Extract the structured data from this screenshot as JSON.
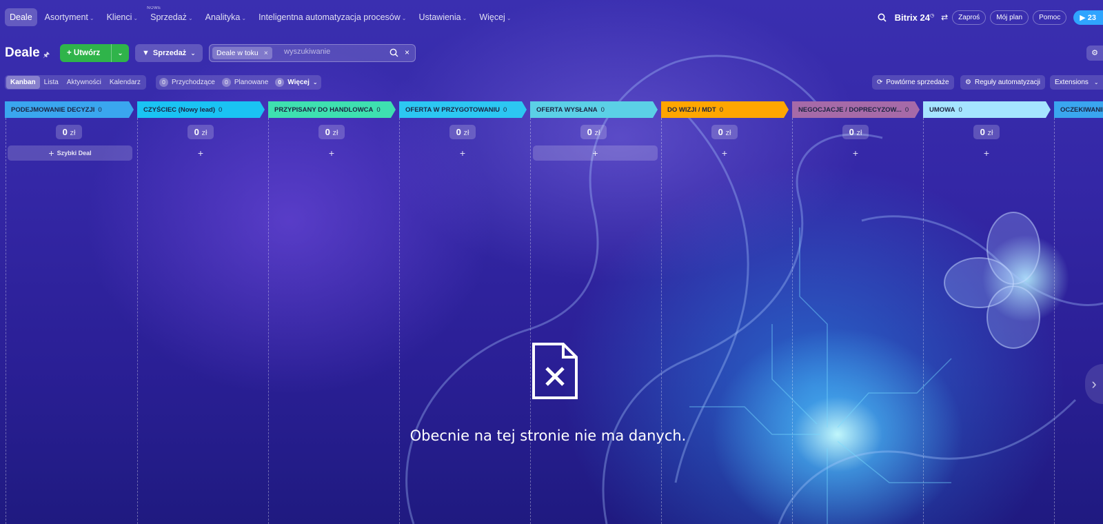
{
  "nav": {
    "items": [
      {
        "label": "Deale",
        "active": true,
        "chevron": false
      },
      {
        "label": "Asortyment",
        "chevron": true
      },
      {
        "label": "Klienci",
        "chevron": true
      },
      {
        "label": "Sprzedaż",
        "chevron": true,
        "badge": "NOWE"
      },
      {
        "label": "Analityka",
        "chevron": true
      },
      {
        "label": "Inteligentna automatyzacja procesów",
        "chevron": true
      },
      {
        "label": "Ustawienia",
        "chevron": true
      },
      {
        "label": "Więcej",
        "chevron": true
      }
    ],
    "brand": "Bitrix 24",
    "invite": "Zaproś",
    "my_plan": "Mój plan",
    "help": "Pomoc",
    "time_badge": "23"
  },
  "toolbar": {
    "title": "Deale",
    "create_label": "Utwórz",
    "funnel_label": "Sprzedaż",
    "filter_chip": "Deale w toku",
    "search_placeholder": "wyszukiwanie"
  },
  "views": {
    "tabs": [
      {
        "label": "Kanban",
        "active": true
      },
      {
        "label": "Lista"
      },
      {
        "label": "Aktywności"
      },
      {
        "label": "Kalendarz"
      }
    ],
    "counters": [
      {
        "count": "0",
        "label": "Przychodzące"
      },
      {
        "count": "0",
        "label": "Planowane"
      }
    ],
    "more_label": "Więcej",
    "repeat_sales": "Powtórne sprzedaże",
    "automation_rules": "Reguły automatyzacji",
    "extensions": "Extensions"
  },
  "stages": [
    {
      "name": "PODEJMOWANIE DECYZJI",
      "count": "0",
      "color": "#3aa6ef",
      "sum": "0",
      "currency": "zł",
      "quick_deal": "Szybki Deal"
    },
    {
      "name": "CZYŚCIEC (Nowy lead)",
      "count": "0",
      "color": "#1ac3f3",
      "sum": "0",
      "currency": "zł"
    },
    {
      "name": "PRZYPISANY DO HANDLOWCA",
      "count": "0",
      "color": "#3ee0b0",
      "sum": "0",
      "currency": "zł"
    },
    {
      "name": "OFERTA W PRZYGOTOWANIU",
      "count": "0",
      "color": "#2cc7f2",
      "sum": "0",
      "currency": "zł"
    },
    {
      "name": "OFERTA WYSŁANA",
      "count": "0",
      "color": "#5bd0e6",
      "sum": "0",
      "currency": "zł"
    },
    {
      "name": "DO WIZJI / MDT",
      "count": "0",
      "color": "#ffa600",
      "sum": "0",
      "currency": "zł"
    },
    {
      "name": "NEGOCJACJE / DOPRECYZOW...",
      "count": "0",
      "color": "#a66aa8",
      "sum": "0",
      "currency": "zł"
    },
    {
      "name": "UMOWA",
      "count": "0",
      "color": "#a5e4ff",
      "sum": "0",
      "currency": "zł"
    },
    {
      "name": "OCZEKIWANIE",
      "count": "",
      "color": "#3aa6ef"
    }
  ],
  "empty_state": {
    "message": "Obecnie na tej stronie nie ma danych."
  },
  "icons": {
    "pin": "pin-icon",
    "search": "search-icon",
    "close": "close-icon",
    "settings": "gear-icon",
    "empty": "no-data-file-icon",
    "scroll": "chevron-right-icon"
  }
}
